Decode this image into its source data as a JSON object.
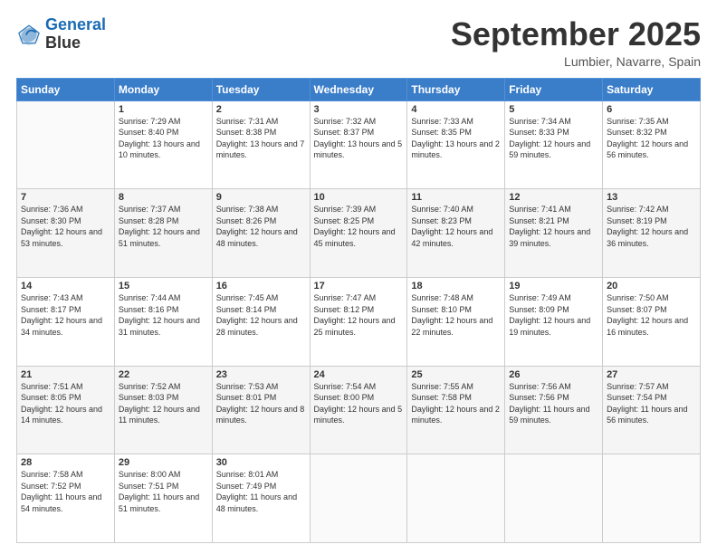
{
  "logo": {
    "line1": "General",
    "line2": "Blue"
  },
  "title": "September 2025",
  "location": "Lumbier, Navarre, Spain",
  "weekdays": [
    "Sunday",
    "Monday",
    "Tuesday",
    "Wednesday",
    "Thursday",
    "Friday",
    "Saturday"
  ],
  "weeks": [
    [
      {
        "day": "",
        "sunrise": "",
        "sunset": "",
        "daylight": ""
      },
      {
        "day": "1",
        "sunrise": "Sunrise: 7:29 AM",
        "sunset": "Sunset: 8:40 PM",
        "daylight": "Daylight: 13 hours and 10 minutes."
      },
      {
        "day": "2",
        "sunrise": "Sunrise: 7:31 AM",
        "sunset": "Sunset: 8:38 PM",
        "daylight": "Daylight: 13 hours and 7 minutes."
      },
      {
        "day": "3",
        "sunrise": "Sunrise: 7:32 AM",
        "sunset": "Sunset: 8:37 PM",
        "daylight": "Daylight: 13 hours and 5 minutes."
      },
      {
        "day": "4",
        "sunrise": "Sunrise: 7:33 AM",
        "sunset": "Sunset: 8:35 PM",
        "daylight": "Daylight: 13 hours and 2 minutes."
      },
      {
        "day": "5",
        "sunrise": "Sunrise: 7:34 AM",
        "sunset": "Sunset: 8:33 PM",
        "daylight": "Daylight: 12 hours and 59 minutes."
      },
      {
        "day": "6",
        "sunrise": "Sunrise: 7:35 AM",
        "sunset": "Sunset: 8:32 PM",
        "daylight": "Daylight: 12 hours and 56 minutes."
      }
    ],
    [
      {
        "day": "7",
        "sunrise": "Sunrise: 7:36 AM",
        "sunset": "Sunset: 8:30 PM",
        "daylight": "Daylight: 12 hours and 53 minutes."
      },
      {
        "day": "8",
        "sunrise": "Sunrise: 7:37 AM",
        "sunset": "Sunset: 8:28 PM",
        "daylight": "Daylight: 12 hours and 51 minutes."
      },
      {
        "day": "9",
        "sunrise": "Sunrise: 7:38 AM",
        "sunset": "Sunset: 8:26 PM",
        "daylight": "Daylight: 12 hours and 48 minutes."
      },
      {
        "day": "10",
        "sunrise": "Sunrise: 7:39 AM",
        "sunset": "Sunset: 8:25 PM",
        "daylight": "Daylight: 12 hours and 45 minutes."
      },
      {
        "day": "11",
        "sunrise": "Sunrise: 7:40 AM",
        "sunset": "Sunset: 8:23 PM",
        "daylight": "Daylight: 12 hours and 42 minutes."
      },
      {
        "day": "12",
        "sunrise": "Sunrise: 7:41 AM",
        "sunset": "Sunset: 8:21 PM",
        "daylight": "Daylight: 12 hours and 39 minutes."
      },
      {
        "day": "13",
        "sunrise": "Sunrise: 7:42 AM",
        "sunset": "Sunset: 8:19 PM",
        "daylight": "Daylight: 12 hours and 36 minutes."
      }
    ],
    [
      {
        "day": "14",
        "sunrise": "Sunrise: 7:43 AM",
        "sunset": "Sunset: 8:17 PM",
        "daylight": "Daylight: 12 hours and 34 minutes."
      },
      {
        "day": "15",
        "sunrise": "Sunrise: 7:44 AM",
        "sunset": "Sunset: 8:16 PM",
        "daylight": "Daylight: 12 hours and 31 minutes."
      },
      {
        "day": "16",
        "sunrise": "Sunrise: 7:45 AM",
        "sunset": "Sunset: 8:14 PM",
        "daylight": "Daylight: 12 hours and 28 minutes."
      },
      {
        "day": "17",
        "sunrise": "Sunrise: 7:47 AM",
        "sunset": "Sunset: 8:12 PM",
        "daylight": "Daylight: 12 hours and 25 minutes."
      },
      {
        "day": "18",
        "sunrise": "Sunrise: 7:48 AM",
        "sunset": "Sunset: 8:10 PM",
        "daylight": "Daylight: 12 hours and 22 minutes."
      },
      {
        "day": "19",
        "sunrise": "Sunrise: 7:49 AM",
        "sunset": "Sunset: 8:09 PM",
        "daylight": "Daylight: 12 hours and 19 minutes."
      },
      {
        "day": "20",
        "sunrise": "Sunrise: 7:50 AM",
        "sunset": "Sunset: 8:07 PM",
        "daylight": "Daylight: 12 hours and 16 minutes."
      }
    ],
    [
      {
        "day": "21",
        "sunrise": "Sunrise: 7:51 AM",
        "sunset": "Sunset: 8:05 PM",
        "daylight": "Daylight: 12 hours and 14 minutes."
      },
      {
        "day": "22",
        "sunrise": "Sunrise: 7:52 AM",
        "sunset": "Sunset: 8:03 PM",
        "daylight": "Daylight: 12 hours and 11 minutes."
      },
      {
        "day": "23",
        "sunrise": "Sunrise: 7:53 AM",
        "sunset": "Sunset: 8:01 PM",
        "daylight": "Daylight: 12 hours and 8 minutes."
      },
      {
        "day": "24",
        "sunrise": "Sunrise: 7:54 AM",
        "sunset": "Sunset: 8:00 PM",
        "daylight": "Daylight: 12 hours and 5 minutes."
      },
      {
        "day": "25",
        "sunrise": "Sunrise: 7:55 AM",
        "sunset": "Sunset: 7:58 PM",
        "daylight": "Daylight: 12 hours and 2 minutes."
      },
      {
        "day": "26",
        "sunrise": "Sunrise: 7:56 AM",
        "sunset": "Sunset: 7:56 PM",
        "daylight": "Daylight: 11 hours and 59 minutes."
      },
      {
        "day": "27",
        "sunrise": "Sunrise: 7:57 AM",
        "sunset": "Sunset: 7:54 PM",
        "daylight": "Daylight: 11 hours and 56 minutes."
      }
    ],
    [
      {
        "day": "28",
        "sunrise": "Sunrise: 7:58 AM",
        "sunset": "Sunset: 7:52 PM",
        "daylight": "Daylight: 11 hours and 54 minutes."
      },
      {
        "day": "29",
        "sunrise": "Sunrise: 8:00 AM",
        "sunset": "Sunset: 7:51 PM",
        "daylight": "Daylight: 11 hours and 51 minutes."
      },
      {
        "day": "30",
        "sunrise": "Sunrise: 8:01 AM",
        "sunset": "Sunset: 7:49 PM",
        "daylight": "Daylight: 11 hours and 48 minutes."
      },
      {
        "day": "",
        "sunrise": "",
        "sunset": "",
        "daylight": ""
      },
      {
        "day": "",
        "sunrise": "",
        "sunset": "",
        "daylight": ""
      },
      {
        "day": "",
        "sunrise": "",
        "sunset": "",
        "daylight": ""
      },
      {
        "day": "",
        "sunrise": "",
        "sunset": "",
        "daylight": ""
      }
    ]
  ]
}
